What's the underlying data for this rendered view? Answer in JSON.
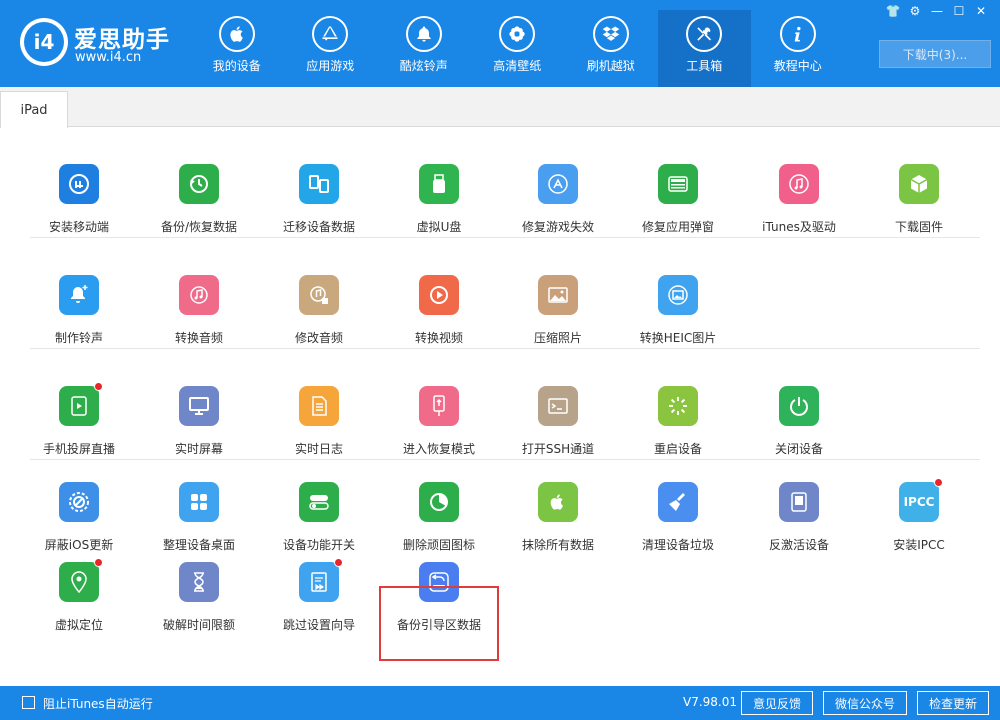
{
  "app": {
    "brand_name": "爱思助手",
    "brand_url": "www.i4.cn",
    "logo_text": "i4"
  },
  "nav": {
    "items": [
      {
        "label": "我的设备",
        "icon": "apple-icon"
      },
      {
        "label": "应用游戏",
        "icon": "app-store-icon"
      },
      {
        "label": "酷炫铃声",
        "icon": "bell-icon"
      },
      {
        "label": "高清壁纸",
        "icon": "flower-icon"
      },
      {
        "label": "刷机越狱",
        "icon": "dropbox-icon"
      },
      {
        "label": "工具箱",
        "icon": "tools-icon",
        "active": true
      },
      {
        "label": "教程中心",
        "icon": "info-icon"
      }
    ]
  },
  "window_controls": [
    "shirt-icon",
    "gear-icon",
    "minimize-icon",
    "maximize-icon",
    "close-icon"
  ],
  "download_label": "下载中(3)...",
  "tabs": [
    {
      "label": "iPad"
    }
  ],
  "tools": [
    {
      "label": "安装移动端",
      "color": "#1f7fe0",
      "icon": "i4-icon"
    },
    {
      "label": "备份/恢复数据",
      "color": "#2eae4b",
      "icon": "clock-restore-icon"
    },
    {
      "label": "迁移设备数据",
      "color": "#22a6e8",
      "icon": "migrate-devices-icon"
    },
    {
      "label": "虚拟U盘",
      "color": "#2fb44f",
      "icon": "usb-drive-icon"
    },
    {
      "label": "修复游戏失效",
      "color": "#4a9ef0",
      "icon": "app-store-repair-icon"
    },
    {
      "label": "修复应用弹窗",
      "color": "#2eae4b",
      "icon": "apple-id-icon"
    },
    {
      "label": "iTunes及驱动",
      "color": "#f0608a",
      "icon": "itunes-icon"
    },
    {
      "label": "下载固件",
      "color": "#7cc443",
      "icon": "cube-icon"
    },
    {
      "label": "制作铃声",
      "color": "#2a9df0",
      "icon": "bell-plus-icon"
    },
    {
      "label": "转换音频",
      "color": "#f06a8a",
      "icon": "music-note-icon"
    },
    {
      "label": "修改音频",
      "color": "#c9a87e",
      "icon": "music-edit-icon"
    },
    {
      "label": "转换视频",
      "color": "#f06a4a",
      "icon": "play-circle-icon"
    },
    {
      "label": "压缩照片",
      "color": "#c9a07a",
      "icon": "photo-icon"
    },
    {
      "label": "转换HEIC图片",
      "color": "#3fa3f0",
      "icon": "heic-photo-icon"
    },
    {
      "label": "手机投屏直播",
      "color": "#2eae4b",
      "icon": "screen-cast-icon",
      "badge": true
    },
    {
      "label": "实时屏幕",
      "color": "#6f87c9",
      "icon": "monitor-icon"
    },
    {
      "label": "实时日志",
      "color": "#f5a53a",
      "icon": "log-document-icon"
    },
    {
      "label": "进入恢复模式",
      "color": "#f06a8a",
      "icon": "recovery-mode-icon"
    },
    {
      "label": "打开SSH通道",
      "color": "#b7a38a",
      "icon": "terminal-icon"
    },
    {
      "label": "重启设备",
      "color": "#8bc53f",
      "icon": "restart-icon"
    },
    {
      "label": "关闭设备",
      "color": "#2eb35a",
      "icon": "power-icon"
    },
    {
      "label": "屏蔽iOS更新",
      "color": "#3d8fe8",
      "icon": "block-update-icon"
    },
    {
      "label": "整理设备桌面",
      "color": "#3fa3f0",
      "icon": "grid-apps-icon"
    },
    {
      "label": "设备功能开关",
      "color": "#2eae4b",
      "icon": "toggle-icon"
    },
    {
      "label": "删除顽固图标",
      "color": "#2eae4b",
      "icon": "pie-chart-icon"
    },
    {
      "label": "抹除所有数据",
      "color": "#7cc443",
      "icon": "apple-erase-icon"
    },
    {
      "label": "清理设备垃圾",
      "color": "#4a8ef0",
      "icon": "broom-icon"
    },
    {
      "label": "反激活设备",
      "color": "#6f87c9",
      "icon": "deactivate-icon"
    },
    {
      "label": "安装IPCC",
      "color": "#3fb0e8",
      "icon": "ipcc-icon",
      "badge": true,
      "icon_text": "IPCC"
    },
    {
      "label": "虚拟定位",
      "color": "#2eae4b",
      "icon": "location-pin-icon",
      "badge": true
    },
    {
      "label": "破解时间限额",
      "color": "#6f87c9",
      "icon": "hourglass-icon"
    },
    {
      "label": "跳过设置向导",
      "color": "#3fa3f0",
      "icon": "skip-setup-icon",
      "badge": true
    },
    {
      "label": "备份引导区数据",
      "color": "#4a7ef0",
      "icon": "backup-boot-icon",
      "selected": true
    }
  ],
  "footer": {
    "checkbox_label": "阻止iTunes自动运行",
    "version": "V7.98.01",
    "buttons": [
      "意见反馈",
      "微信公众号",
      "检查更新"
    ]
  }
}
